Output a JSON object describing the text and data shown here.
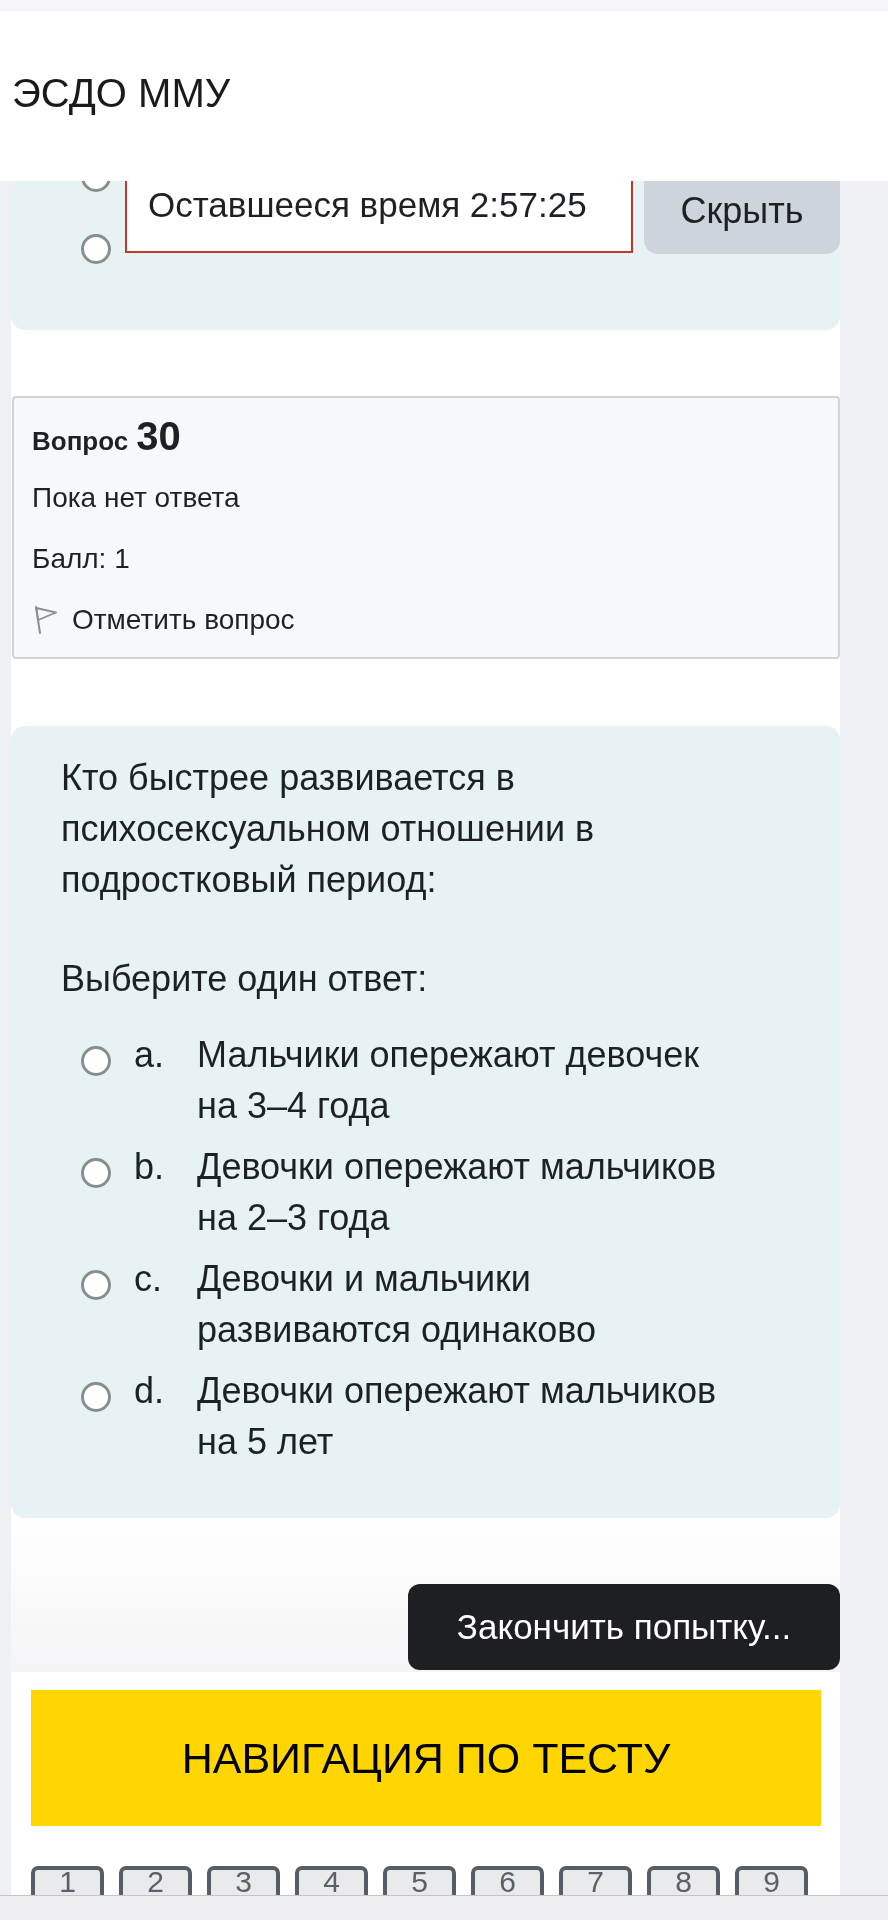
{
  "header": {
    "title": "ЭСДО ММУ"
  },
  "previous_question": {
    "options": [
      {
        "selected": false
      },
      {
        "selected": false
      }
    ]
  },
  "timer": {
    "text": "Оставшееся время 2:57:25",
    "hide_button": "Скрыть"
  },
  "question_info": {
    "label": "Вопрос",
    "number": "30",
    "status": "Пока нет ответа",
    "score": "Балл: 1",
    "flag": {
      "label": "Отметить вопрос",
      "flagged": false
    }
  },
  "question": {
    "text": "Кто быстрее развивается в психосексуальном отношении в подростковый период:",
    "prompt": "Выберите один ответ:",
    "options": [
      {
        "letter": "a.",
        "text": "Мальчики опережают девочек на 3–4 года",
        "selected": false
      },
      {
        "letter": "b.",
        "text": "Девочки опережают мальчиков на 2–3 года",
        "selected": false
      },
      {
        "letter": "c.",
        "text": "Девочки и мальчики развиваются одинаково",
        "selected": false
      },
      {
        "letter": "d.",
        "text": "Девочки опережают мальчиков на 5 лет",
        "selected": false
      }
    ]
  },
  "finish_button": "Закончить попытку...",
  "navigation": {
    "title": "НАВИГАЦИЯ ПО ТЕСТУ",
    "buttons": [
      {
        "label": "1"
      },
      {
        "label": "2"
      },
      {
        "label": "3"
      },
      {
        "label": "4"
      },
      {
        "label": "5"
      },
      {
        "label": "6"
      },
      {
        "label": "7"
      },
      {
        "label": "8"
      },
      {
        "label": "9"
      }
    ]
  }
}
